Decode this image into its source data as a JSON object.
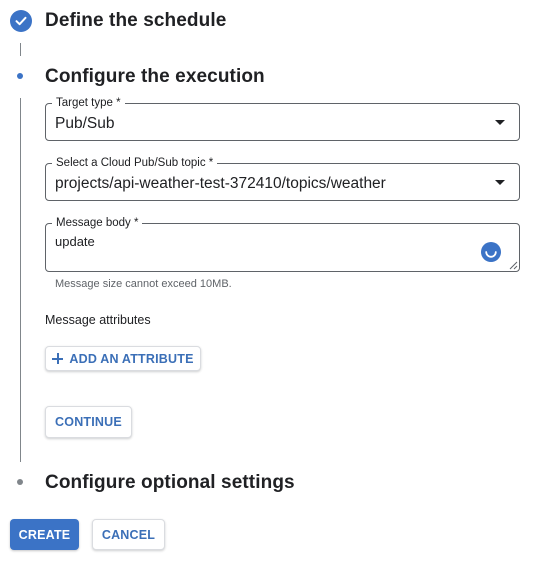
{
  "steps": {
    "define": {
      "title": "Define the schedule",
      "state": "completed"
    },
    "configure": {
      "title": "Configure the execution",
      "state": "active"
    },
    "optional": {
      "title": "Configure optional settings",
      "state": "pending"
    }
  },
  "form": {
    "target_type": {
      "label": "Target type *",
      "value": "Pub/Sub"
    },
    "topic": {
      "label": "Select a Cloud Pub/Sub topic *",
      "value": "projects/api-weather-test-372410/topics/weather"
    },
    "message_body": {
      "label": "Message body *",
      "value": "update",
      "hint": "Message size cannot exceed 10MB."
    },
    "attributes": {
      "label": "Message attributes",
      "add_label": "ADD AN ATTRIBUTE"
    },
    "continue_label": "CONTINUE"
  },
  "actions": {
    "create_label": "CREATE",
    "cancel_label": "CANCEL"
  },
  "colors": {
    "primary": "#3b73c6",
    "text": "#202124",
    "secondary_text": "#5f6368",
    "outline": "#5f6368"
  },
  "icons": {
    "completed": "check-circle-icon",
    "active": "dot-icon",
    "dropdown": "chevron-down-icon",
    "loading": "loading-spinner-icon",
    "add": "plus-icon"
  }
}
